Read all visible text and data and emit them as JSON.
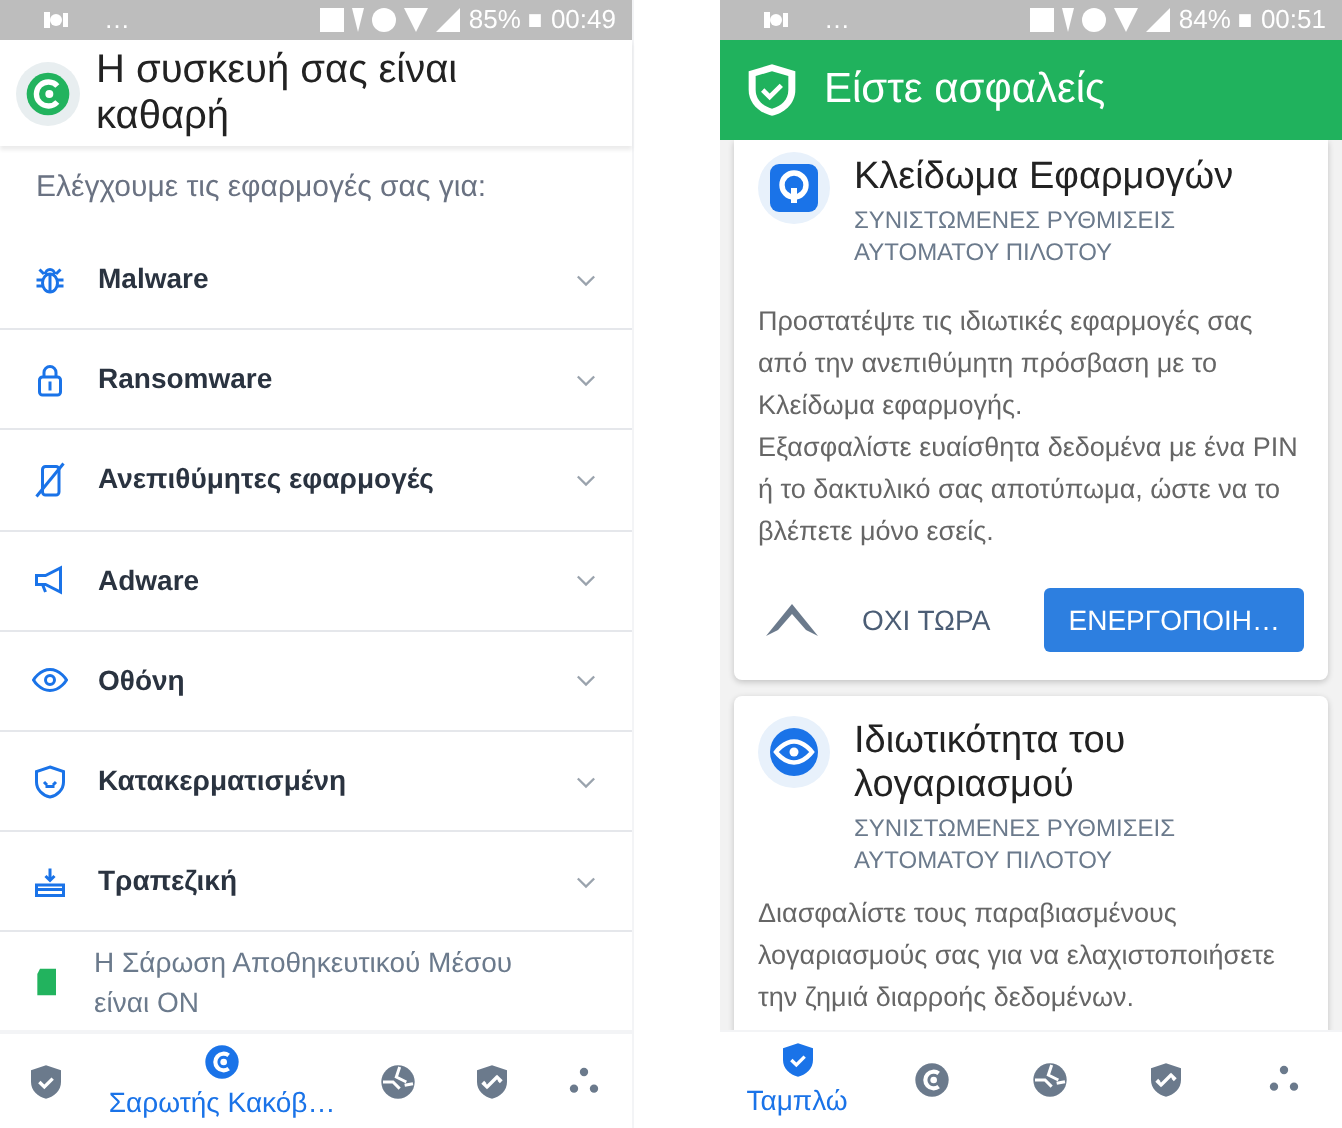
{
  "left_screen": {
    "status_bar": {
      "overflow": "…",
      "battery": "85%",
      "time": "00:49"
    },
    "header": {
      "title": "Η συσκευή σας είναι καθαρή"
    },
    "subtitle": "Ελέγχουμε τις εφαρμογές σας για:",
    "checks": [
      {
        "label": "Malware",
        "kind": "bug"
      },
      {
        "label": "Ransomware",
        "kind": "lock"
      },
      {
        "label": "Ανεπιθύμητες εφαρμογές",
        "kind": "phone"
      },
      {
        "label": "Adware",
        "kind": "megaphone"
      },
      {
        "label": "Οθόνη",
        "kind": "eye"
      },
      {
        "label": "Κατακερματισμένη",
        "kind": "shield"
      },
      {
        "label": "Τραπεζική",
        "kind": "bank"
      }
    ],
    "storage_scan": {
      "text": "Η Σάρωση Αποθηκευτικού Μέσου είναι ON",
      "on": true
    },
    "bottom_nav": [
      {
        "kind": "shield",
        "selected": false
      },
      {
        "kind": "scanner",
        "selected": true,
        "label": "Σαρωτής Κακόβ…"
      },
      {
        "kind": "globe",
        "selected": false
      },
      {
        "kind": "link",
        "selected": false
      },
      {
        "kind": "dots",
        "selected": false
      }
    ]
  },
  "right_screen": {
    "status_bar": {
      "overflow": "…",
      "battery": "84%",
      "time": "00:51"
    },
    "header": {
      "title": "Είστε ασφαλείς"
    },
    "cards": [
      {
        "kind": "lock",
        "title": "Κλείδωμα Εφαρμογών",
        "subtitle": "ΣΥΝΙΣΤΩΜΕΝΕΣ ΡΥΘΜΙΣΕΙΣ ΑΥΤΟΜΑΤΟΥ ΠΙΛΟΤΟΥ",
        "body": [
          "Προστατέψτε τις ιδιωτικές εφαρμογές σας από την ανεπιθύμητη πρόσβαση με το Κλείδωμα εφαρμογής.",
          "Εξασφαλίστε ευαίσθητα δεδομένα με ένα PIN ή το δακτυλικό σας αποτύπωμα, ώστε να το βλέπετε μόνο εσείς."
        ],
        "secondary_action": "ΟΧΙ ΤΩΡΑ",
        "primary_action": "ΕΝΕΡΓΟΠΟΙΗ…"
      },
      {
        "kind": "privacy",
        "title": "Ιδιωτικότητα του λογαριασμού",
        "subtitle": "ΣΥΝΙΣΤΩΜΕΝΕΣ ΡΥΘΜΙΣΕΙΣ ΑΥΤΟΜΑΤΟΥ ΠΙΛΟΤΟΥ",
        "body": [
          "Διασφαλίστε τους παραβιασμένους λογαριασμούς σας για να ελαχιστοποιήσετε την ζημιά διαρροής δεδομένων."
        ]
      }
    ],
    "bottom_nav": [
      {
        "kind": "shield",
        "selected": true,
        "label": "Ταμπλώ"
      },
      {
        "kind": "scanner",
        "selected": false
      },
      {
        "kind": "globe",
        "selected": false
      },
      {
        "kind": "link",
        "selected": false
      },
      {
        "kind": "dots",
        "selected": false
      }
    ]
  }
}
